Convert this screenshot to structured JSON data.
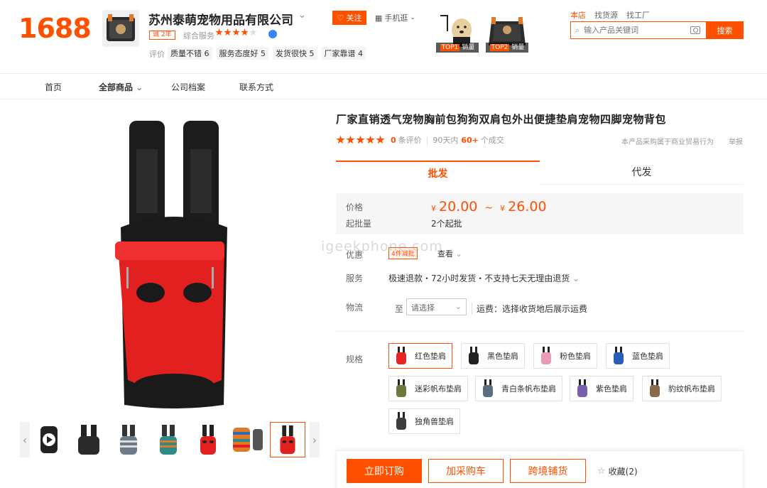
{
  "header": {
    "logo": "1688",
    "shop_name": "苏州泰萌宠物用品有限公司",
    "follow_label": "关注",
    "mobile_label": "手机逛",
    "years_badge": "诚 2年",
    "overall_label": "综合服务",
    "overall_stars": 4,
    "rating_label": "评价",
    "ratings": [
      "质量不错 6",
      "服务态度好 5",
      "发货很快 5",
      "厂家靠谱 4"
    ],
    "top_products": [
      {
        "rank": "TOP1",
        "label": "销量"
      },
      {
        "rank": "TOP2",
        "label": "销量"
      }
    ],
    "scope_tabs": [
      "本店",
      "找货源",
      "找工厂"
    ],
    "search_placeholder": "输入产品关键词",
    "search_button": "搜索"
  },
  "nav": {
    "items": [
      "首页",
      "全部商品",
      "公司档案",
      "联系方式"
    ]
  },
  "product": {
    "title": "厂家直销透气宠物胸前包狗狗双肩包外出便捷垫肩宠物四脚宠物背包",
    "review_count": "0",
    "review_label": "条评价",
    "sales_prefix": "90天内",
    "sales_count": "60+",
    "sales_label": "个成交",
    "policy_text": "本产品采购属于商业贸易行为",
    "report_label": "举报",
    "modes": [
      "批发",
      "代发"
    ],
    "price_label": "价格",
    "currency": "¥",
    "price_min": "20.00",
    "price_max": "26.00",
    "moq_label": "起批量",
    "moq_value": "2个起批",
    "discount_label": "优惠",
    "discount_tag": "4件减批",
    "discount_more": "查看",
    "service_label": "服务",
    "service_text": "极速退款・72小时发货・不支持七天无理由退货",
    "logistics_label": "物流",
    "ship_to": "至",
    "region_placeholder": "请选择",
    "ship_info": "运费：选择收货地后展示运费",
    "spec_label": "规格",
    "specs": [
      {
        "label": "红色垫肩",
        "color": "#e62525"
      },
      {
        "label": "黑色垫肩",
        "color": "#222222"
      },
      {
        "label": "粉色垫肩",
        "color": "#e89ab8"
      },
      {
        "label": "蓝色垫肩",
        "color": "#2a5fb5"
      },
      {
        "label": "迷彩帆布垫肩",
        "color": "#6b7a3c"
      },
      {
        "label": "青白条帆布垫肩",
        "color": "#5a6f80"
      },
      {
        "label": "紫色垫肩",
        "color": "#7a5fb0"
      },
      {
        "label": "豹纹帆布垫肩",
        "color": "#8a6a4a"
      },
      {
        "label": "独角兽垫肩",
        "color": "#3d3d3d"
      }
    ],
    "buy_now": "立即订购",
    "add_cart": "加采购车",
    "cross_border": "跨境铺货",
    "favorite": "收藏(2)"
  },
  "watermark": "igeekphone.com"
}
